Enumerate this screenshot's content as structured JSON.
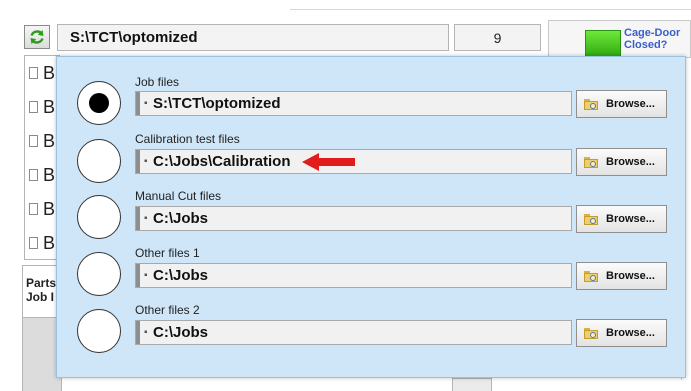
{
  "app": {
    "current_path": "S:\\TCT\\optomized",
    "count": "9",
    "cage_status": "Cage-Door Closed?",
    "list_items": [
      "B",
      "B",
      "B",
      "B",
      "B",
      "B"
    ],
    "props_label_1": "Parts",
    "props_label_2": "Job I",
    "led_color": "#3cc21a"
  },
  "dialog": {
    "browse_label": "Browse...",
    "selected_index": 0,
    "rows": [
      {
        "label": "Job files",
        "path": "S:\\TCT\\optomized",
        "selected": true
      },
      {
        "label": "Calibration test files",
        "path": "C:\\Jobs\\Calibration",
        "selected": false,
        "annotation": "red-arrow"
      },
      {
        "label": "Manual Cut files",
        "path": "C:\\Jobs",
        "selected": false
      },
      {
        "label": "Other files 1",
        "path": "C:\\Jobs",
        "selected": false
      },
      {
        "label": "Other files 2",
        "path": "C:\\Jobs",
        "selected": false
      }
    ]
  },
  "icons": {
    "refresh": "refresh-icon",
    "document": "document-icon",
    "folder_browse": "folder-search-icon",
    "annotation": "red-arrow-icon"
  },
  "colors": {
    "dialog_bg": "#cfe6f8",
    "cage_label": "#3b5ec9",
    "annotation_arrow": "#e21b1b"
  }
}
